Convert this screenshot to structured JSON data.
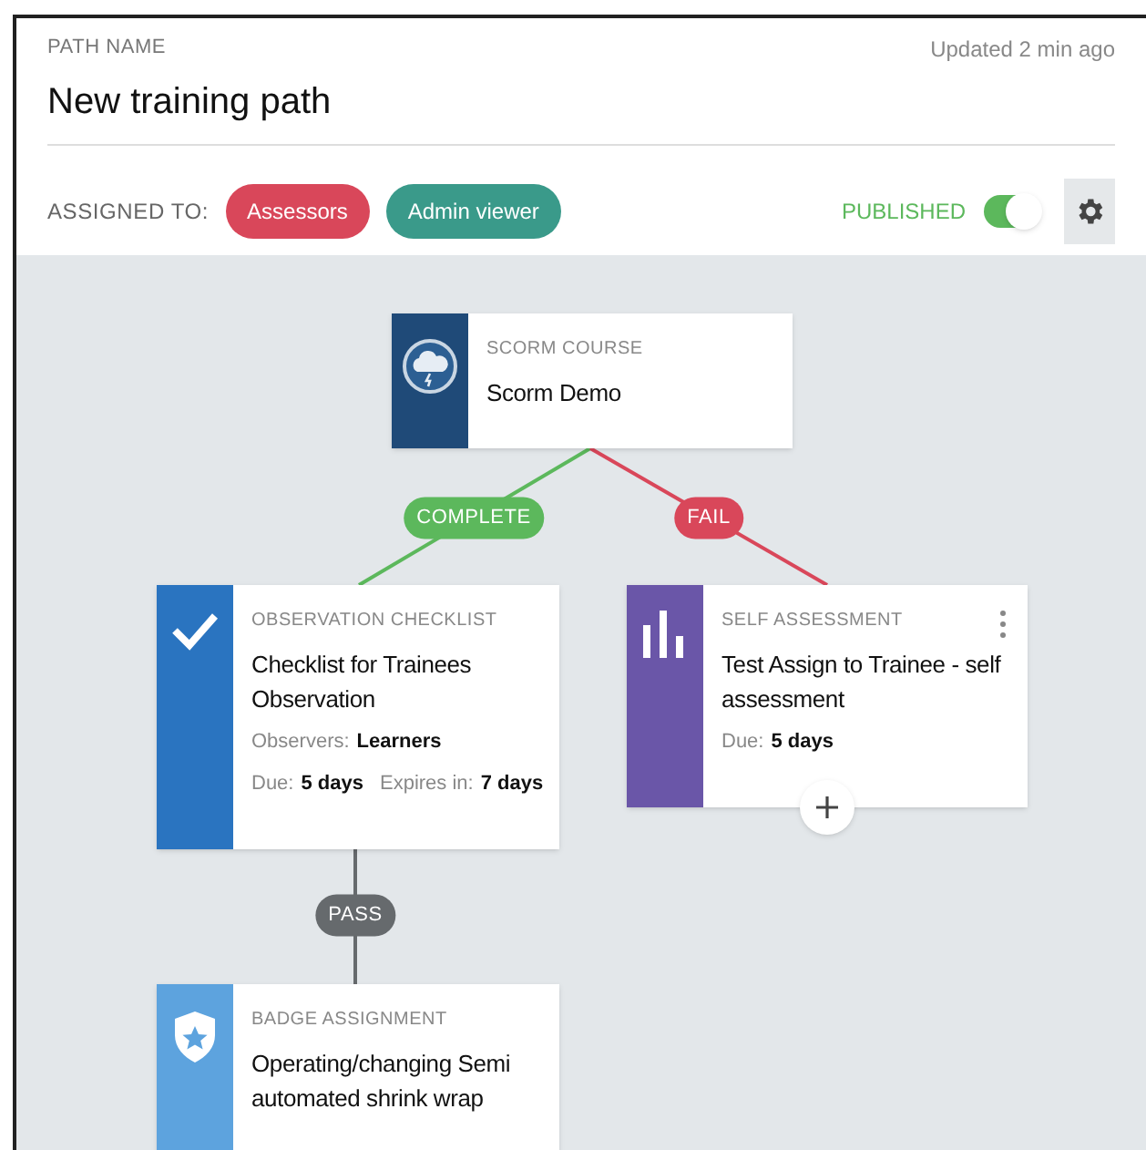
{
  "header": {
    "label": "PATH NAME",
    "title": "New training path",
    "updated": "Updated 2 min ago",
    "assigned_label": "ASSIGNED TO:",
    "tags": [
      {
        "label": "Assessors",
        "color": "#d9475a"
      },
      {
        "label": "Admin viewer",
        "color": "#3a9a8a"
      }
    ],
    "published": {
      "label": "PUBLISHED",
      "on": true
    }
  },
  "nodes": [
    {
      "kind": "scorm",
      "type": "SCORM COURSE",
      "title": "Scorm Demo"
    },
    {
      "kind": "checklist",
      "type": "OBSERVATION CHECKLIST",
      "title": "Checklist for Trainees Observation",
      "details": [
        [
          {
            "label": "Observers:",
            "value": "Learners"
          }
        ],
        [
          {
            "label": "Due:",
            "value": "5 days"
          },
          {
            "label": "Expires in:",
            "value": "7 days"
          }
        ]
      ]
    },
    {
      "kind": "assessment",
      "type": "SELF ASSESSMENT",
      "title": "Test Assign to Trainee - self assessment",
      "menu": true,
      "add_button": true,
      "details": [
        [
          {
            "label": "Due:",
            "value": "5 days"
          }
        ]
      ]
    },
    {
      "kind": "badge",
      "type": "BADGE ASSIGNMENT",
      "title": "Operating/changing Semi automated shrink wrap"
    }
  ],
  "edges": [
    {
      "label": "COMPLETE",
      "color": "#5cb85c"
    },
    {
      "label": "FAIL",
      "color": "#d9475a"
    },
    {
      "label": "PASS",
      "color": "#666a6d"
    }
  ]
}
